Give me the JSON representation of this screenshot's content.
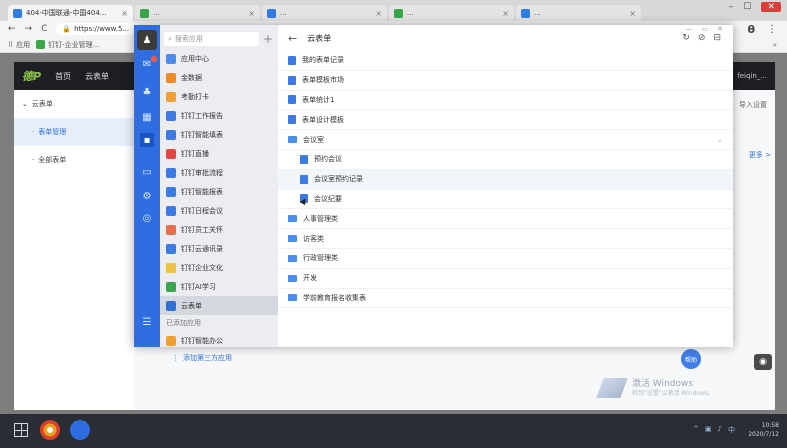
{
  "browser": {
    "tabs": [
      {
        "title": "404-中国联通-中国404...",
        "active": true
      },
      {
        "title": "...",
        "active": false
      },
      {
        "title": "...",
        "active": false
      },
      {
        "title": "...",
        "active": false
      },
      {
        "title": "...",
        "active": false
      }
    ],
    "url": "https://www.5...",
    "bookmarks": [
      "应用",
      "钉钉-企业管理..."
    ],
    "bookmarks_more": "»",
    "profile": "θ"
  },
  "app": {
    "logo": "德P",
    "nav": [
      "首页",
      "云表单"
    ],
    "user": "feiqin_...",
    "sidebar": [
      {
        "label": "云表单",
        "kind": "group"
      },
      {
        "label": "表单管理",
        "kind": "sub-active"
      },
      {
        "label": "全部表单",
        "kind": "sub"
      }
    ],
    "right_text": "导入设置",
    "right_link": "更多 >",
    "watermark_line1": "激活 Windows",
    "watermark_line2": "转到\"设置\"以激活 Windows。",
    "float_label": "帮助"
  },
  "dingtalk": {
    "search_placeholder": "搜索应用",
    "list": {
      "items": [
        {
          "label": "应用中心",
          "color": "#4a8cf0"
        },
        {
          "label": "金数据",
          "color": "#f08a24"
        },
        {
          "label": "考勤打卡",
          "color": "#f0a030"
        },
        {
          "label": "钉钉工作报告",
          "color": "#3c7be6"
        },
        {
          "label": "钉钉智能填表",
          "color": "#3c7be6"
        },
        {
          "label": "钉钉直播",
          "color": "#e64545"
        },
        {
          "label": "钉钉审批流程",
          "color": "#3c7be6"
        },
        {
          "label": "钉钉智能报表",
          "color": "#3c7be6"
        },
        {
          "label": "钉钉日程会议",
          "color": "#3c7be6"
        },
        {
          "label": "钉钉员工关怀",
          "color": "#e6704a"
        },
        {
          "label": "钉钉云通讯录",
          "color": "#3c7be6"
        },
        {
          "label": "钉钉企业文化",
          "color": "#f0c040"
        },
        {
          "label": "钉钉AI学习",
          "color": "#3aa64c"
        },
        {
          "label": "云表单",
          "color": "#2f6fd6",
          "active": true
        }
      ],
      "section_label": "已添加应用",
      "after_section": [
        {
          "label": "钉钉智能办公",
          "color": "#f0a030"
        }
      ],
      "more_label": "添加第三方应用"
    },
    "main": {
      "title": "云表单",
      "rows": [
        {
          "label": "我的表单记录",
          "type": "doc",
          "level": 0
        },
        {
          "label": "表单模板市场",
          "type": "doc",
          "level": 0
        },
        {
          "label": "表单统计1",
          "type": "doc",
          "level": 0
        },
        {
          "label": "表单设计模板",
          "type": "doc",
          "level": 0
        },
        {
          "label": "会议室",
          "type": "folder",
          "level": 0,
          "chevron": true
        },
        {
          "label": "预约会议",
          "type": "doc",
          "level": 1
        },
        {
          "label": "会议室预约记录",
          "type": "doc",
          "level": 1,
          "highlighted": true
        },
        {
          "label": "会议纪要",
          "type": "doc",
          "level": 1
        },
        {
          "label": "人事管理类",
          "type": "folder",
          "level": 0
        },
        {
          "label": "访客类",
          "type": "folder",
          "level": 0
        },
        {
          "label": "行政管理类",
          "type": "folder",
          "level": 0
        },
        {
          "label": "开发",
          "type": "folder",
          "level": 0
        },
        {
          "label": "学前教育报名收集表",
          "type": "folder",
          "level": 0
        }
      ]
    }
  },
  "taskbar": {
    "time": "10:58",
    "date": "2020/7/12"
  }
}
